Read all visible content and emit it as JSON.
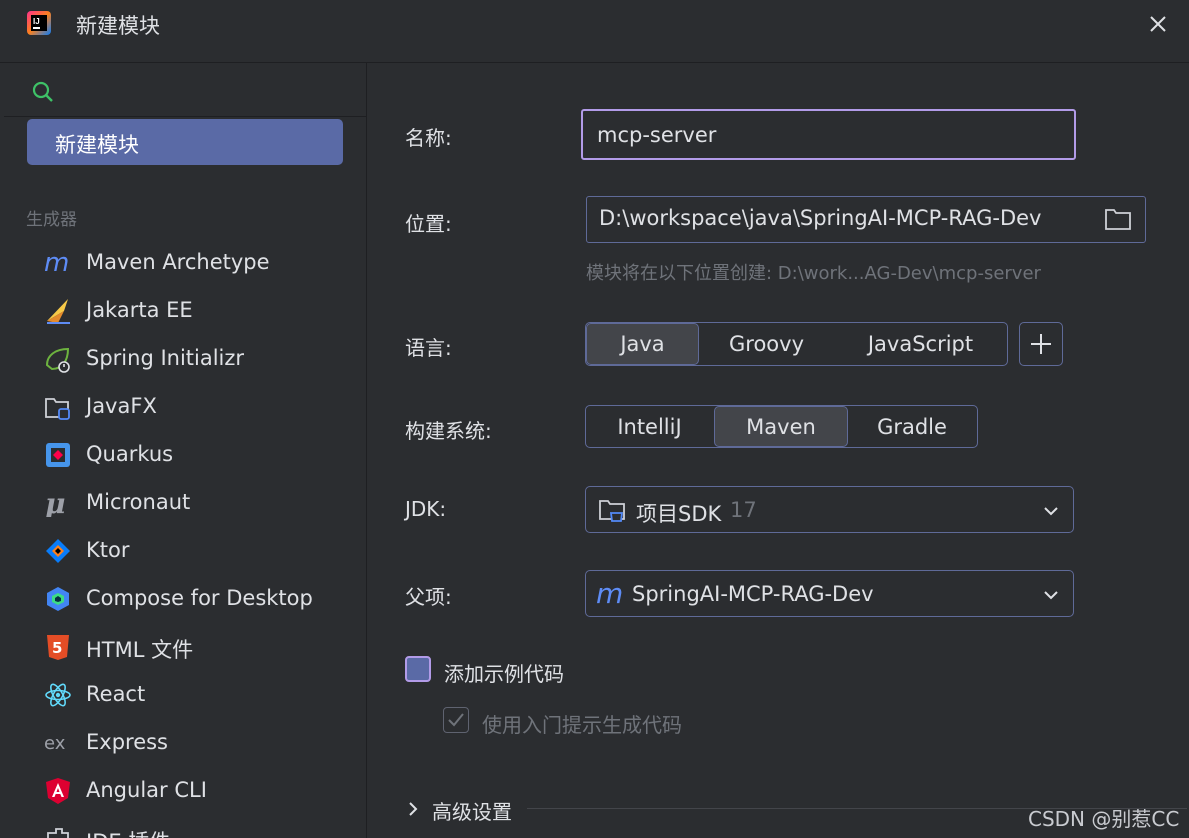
{
  "window": {
    "title": "新建模块",
    "close_icon": "close-icon"
  },
  "sidebar": {
    "search_icon": "search-icon",
    "selected_item": "新建模块",
    "section_label": "生成器",
    "generators": [
      {
        "label": "Maven Archetype",
        "icon": "maven-icon"
      },
      {
        "label": "Jakarta EE",
        "icon": "jakarta-ee-icon"
      },
      {
        "label": "Spring Initializr",
        "icon": "spring-icon"
      },
      {
        "label": "JavaFX",
        "icon": "javafx-folder-icon"
      },
      {
        "label": "Quarkus",
        "icon": "quarkus-icon"
      },
      {
        "label": "Micronaut",
        "icon": "micronaut-icon"
      },
      {
        "label": "Ktor",
        "icon": "ktor-icon"
      },
      {
        "label": "Compose for Desktop",
        "icon": "compose-icon"
      },
      {
        "label": "HTML 文件",
        "icon": "html5-icon"
      },
      {
        "label": "React",
        "icon": "react-icon"
      },
      {
        "label": "Express",
        "icon": "express-icon"
      },
      {
        "label": "Angular CLI",
        "icon": "angular-icon"
      },
      {
        "label": "IDE 插件",
        "icon": "ide-plugin-icon"
      }
    ]
  },
  "form": {
    "name_label": "名称:",
    "name_value": "mcp-server",
    "location_label": "位置:",
    "location_value": "D:\\workspace\\java\\SpringAI-MCP-RAG-Dev",
    "location_hint": "模块将在以下位置创建: D:\\work...AG-Dev\\mcp-server",
    "language_label": "语言:",
    "languages": [
      "Java",
      "Groovy",
      "JavaScript"
    ],
    "language_selected": "Java",
    "build_label": "构建系统:",
    "build_systems": [
      "IntelliJ",
      "Maven",
      "Gradle"
    ],
    "build_selected": "Maven",
    "jdk_label": "JDK:",
    "jdk_value": "项目SDK",
    "jdk_version": "17",
    "parent_label": "父项:",
    "parent_value": "SpringAI-MCP-RAG-Dev",
    "sample_code_label": "添加示例代码",
    "sample_code_checked": false,
    "onboarding_label": "使用入门提示生成代码",
    "onboarding_checked": true,
    "advanced_label": "高级设置"
  },
  "watermark": "CSDN @别惹CC",
  "colors": {
    "selection": "#5a6aa6",
    "focus_border": "#b29be8",
    "background": "#2b2d30",
    "border": "#5f6a98"
  }
}
